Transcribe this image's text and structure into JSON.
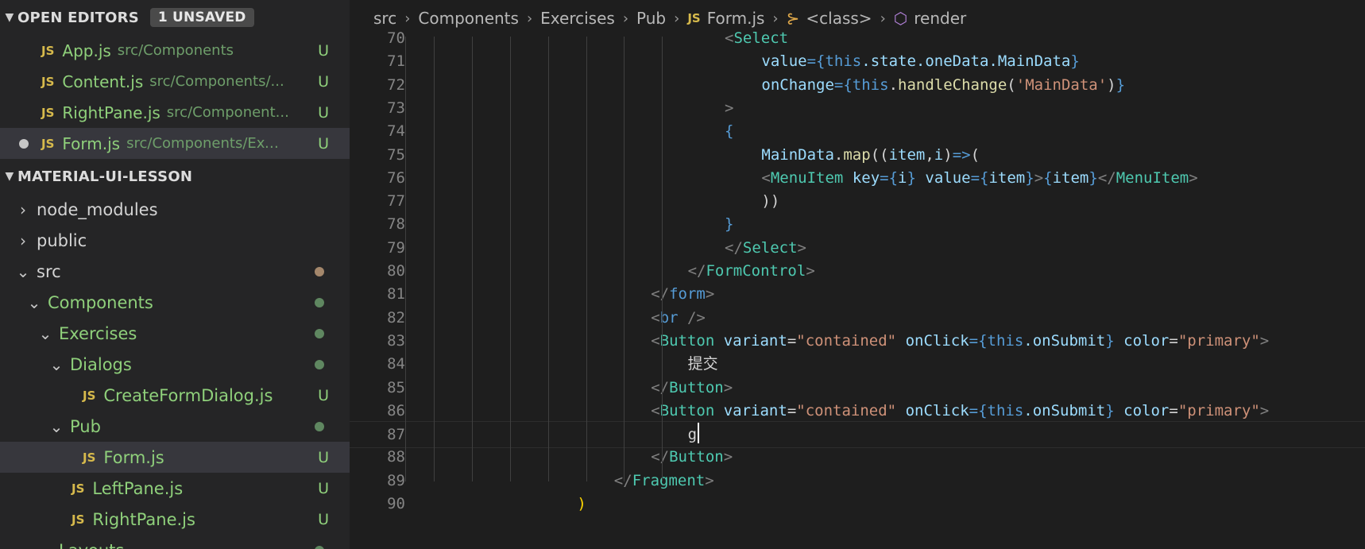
{
  "sidebar": {
    "open_editors": {
      "title": "OPEN EDITORS",
      "badge": "1 UNSAVED",
      "items": [
        {
          "name": "App.js",
          "path": "src/Components",
          "status": "U",
          "unsaved": false
        },
        {
          "name": "Content.js",
          "path": "src/Components/...",
          "status": "U",
          "unsaved": false
        },
        {
          "name": "RightPane.js",
          "path": "src/Component...",
          "status": "U",
          "unsaved": false
        },
        {
          "name": "Form.js",
          "path": "src/Components/Exe...",
          "status": "U",
          "unsaved": true
        }
      ]
    },
    "explorer": {
      "title": "MATERIAL-UI-LESSON",
      "items": [
        {
          "label": "node_modules",
          "kind": "folder",
          "expanded": false,
          "depth": 0,
          "style": "plain"
        },
        {
          "label": "public",
          "kind": "folder",
          "expanded": false,
          "depth": 0,
          "style": "plain"
        },
        {
          "label": "src",
          "kind": "folder",
          "expanded": true,
          "depth": 0,
          "style": "plain",
          "marker": "dot-brown"
        },
        {
          "label": "Components",
          "kind": "folder",
          "expanded": true,
          "depth": 1,
          "style": "green",
          "marker": "dot-green"
        },
        {
          "label": "Exercises",
          "kind": "folder",
          "expanded": true,
          "depth": 2,
          "style": "green",
          "marker": "dot-green"
        },
        {
          "label": "Dialogs",
          "kind": "folder",
          "expanded": true,
          "depth": 3,
          "style": "green",
          "marker": "dot-green"
        },
        {
          "label": "CreateFormDialog.js",
          "kind": "file",
          "depth": 4,
          "status": "U"
        },
        {
          "label": "Pub",
          "kind": "folder",
          "expanded": true,
          "depth": 3,
          "style": "green",
          "marker": "dot-green"
        },
        {
          "label": "Form.js",
          "kind": "file",
          "depth": 4,
          "status": "U",
          "selected": true
        },
        {
          "label": "LeftPane.js",
          "kind": "file",
          "depth": 3,
          "status": "U"
        },
        {
          "label": "RightPane.js",
          "kind": "file",
          "depth": 3,
          "status": "U"
        },
        {
          "label": "Layouts",
          "kind": "folder",
          "expanded": true,
          "depth": 2,
          "style": "green",
          "marker": "dot-green"
        }
      ]
    }
  },
  "breadcrumb": {
    "parts": [
      "src",
      "Components",
      "Exercises",
      "Pub"
    ],
    "file": "Form.js",
    "file_icon": "JS",
    "class_symbol": "<class>",
    "method_symbol": "render"
  },
  "editor": {
    "current_line": 87,
    "lines": [
      {
        "n": "70",
        "indent": 15,
        "tokens": [
          [
            "<",
            "ang"
          ],
          [
            "Select",
            "tag"
          ]
        ]
      },
      {
        "n": "71",
        "indent": 17,
        "tokens": [
          [
            "value",
            "attr"
          ],
          [
            "={",
            "brace"
          ],
          [
            "this",
            "kw"
          ],
          [
            ".state.oneData.MainData",
            "attr"
          ],
          [
            "}",
            "brace"
          ]
        ]
      },
      {
        "n": "72",
        "indent": 17,
        "tokens": [
          [
            "onChange",
            "attr"
          ],
          [
            "={",
            "brace"
          ],
          [
            "this",
            "kw"
          ],
          [
            ".",
            "pl"
          ],
          [
            "handleChange",
            "fn"
          ],
          [
            "(",
            "pl"
          ],
          [
            "'MainData'",
            "str"
          ],
          [
            ")",
            "pl"
          ],
          [
            "}",
            "brace"
          ]
        ]
      },
      {
        "n": "73",
        "indent": 15,
        "tokens": [
          [
            ">",
            "ang"
          ]
        ]
      },
      {
        "n": "74",
        "indent": 15,
        "tokens": [
          [
            "{",
            "brace"
          ]
        ]
      },
      {
        "n": "75",
        "indent": 17,
        "tokens": [
          [
            "MainData",
            "attr"
          ],
          [
            ".",
            "pl"
          ],
          [
            "map",
            "fn"
          ],
          [
            "((",
            "pl"
          ],
          [
            "item",
            "attr"
          ],
          [
            ",",
            "pl"
          ],
          [
            "i",
            "attr"
          ],
          [
            ")",
            "pl"
          ],
          [
            "=>",
            "kw"
          ],
          [
            "(",
            "pl"
          ]
        ]
      },
      {
        "n": "76",
        "indent": 17,
        "tokens": [
          [
            "<",
            "ang"
          ],
          [
            "MenuItem",
            "tag"
          ],
          [
            " ",
            "pl"
          ],
          [
            "key",
            "attr"
          ],
          [
            "={",
            "brace"
          ],
          [
            "i",
            "attr"
          ],
          [
            "}",
            "brace"
          ],
          [
            " ",
            "pl"
          ],
          [
            "value",
            "attr"
          ],
          [
            "={",
            "brace"
          ],
          [
            "item",
            "attr"
          ],
          [
            "}",
            "brace"
          ],
          [
            ">",
            "ang"
          ],
          [
            "{",
            "brace"
          ],
          [
            "item",
            "attr"
          ],
          [
            "}",
            "brace"
          ],
          [
            "</",
            "ang"
          ],
          [
            "MenuItem",
            "tag"
          ],
          [
            ">",
            "ang"
          ]
        ]
      },
      {
        "n": "77",
        "indent": 17,
        "tokens": [
          [
            "))",
            "pl"
          ]
        ]
      },
      {
        "n": "78",
        "indent": 15,
        "tokens": [
          [
            "}",
            "brace"
          ]
        ]
      },
      {
        "n": "79",
        "indent": 15,
        "tokens": [
          [
            "</",
            "ang"
          ],
          [
            "Select",
            "tag"
          ],
          [
            ">",
            "ang"
          ]
        ]
      },
      {
        "n": "80",
        "indent": 13,
        "tokens": [
          [
            "</",
            "ang"
          ],
          [
            "FormControl",
            "tag"
          ],
          [
            ">",
            "ang"
          ]
        ]
      },
      {
        "n": "81",
        "indent": 11,
        "tokens": [
          [
            "</",
            "ang"
          ],
          [
            "form",
            "html"
          ],
          [
            ">",
            "ang"
          ]
        ]
      },
      {
        "n": "82",
        "indent": 11,
        "tokens": [
          [
            "<",
            "ang"
          ],
          [
            "br",
            "html"
          ],
          [
            " />",
            "ang"
          ]
        ]
      },
      {
        "n": "83",
        "indent": 11,
        "tokens": [
          [
            "<",
            "ang"
          ],
          [
            "Button",
            "tag"
          ],
          [
            " ",
            "pl"
          ],
          [
            "variant",
            "attr"
          ],
          [
            "=",
            "pl"
          ],
          [
            "\"contained\"",
            "str"
          ],
          [
            " ",
            "pl"
          ],
          [
            "onClick",
            "attr"
          ],
          [
            "={",
            "brace"
          ],
          [
            "this",
            "kw"
          ],
          [
            ".onSubmit",
            "attr"
          ],
          [
            "}",
            "brace"
          ],
          [
            " ",
            "pl"
          ],
          [
            "color",
            "attr"
          ],
          [
            "=",
            "pl"
          ],
          [
            "\"primary\"",
            "str"
          ],
          [
            ">",
            "ang"
          ]
        ]
      },
      {
        "n": "84",
        "indent": 13,
        "tokens": [
          [
            "提交",
            "pl"
          ]
        ]
      },
      {
        "n": "85",
        "indent": 11,
        "tokens": [
          [
            "</",
            "ang"
          ],
          [
            "Button",
            "tag"
          ],
          [
            ">",
            "ang"
          ]
        ]
      },
      {
        "n": "86",
        "indent": 11,
        "tokens": [
          [
            "<",
            "ang"
          ],
          [
            "Button",
            "tag"
          ],
          [
            " ",
            "pl"
          ],
          [
            "variant",
            "attr"
          ],
          [
            "=",
            "pl"
          ],
          [
            "\"contained\"",
            "str"
          ],
          [
            " ",
            "pl"
          ],
          [
            "onClick",
            "attr"
          ],
          [
            "={",
            "brace"
          ],
          [
            "this",
            "kw"
          ],
          [
            ".onSubmit",
            "attr"
          ],
          [
            "}",
            "brace"
          ],
          [
            " ",
            "pl"
          ],
          [
            "color",
            "attr"
          ],
          [
            "=",
            "pl"
          ],
          [
            "\"primary\"",
            "str"
          ],
          [
            ">",
            "ang"
          ]
        ]
      },
      {
        "n": "87",
        "indent": 13,
        "tokens": [
          [
            "g",
            "pl"
          ]
        ]
      },
      {
        "n": "88",
        "indent": 11,
        "tokens": [
          [
            "</",
            "ang"
          ],
          [
            "Button",
            "tag"
          ],
          [
            ">",
            "ang"
          ]
        ]
      },
      {
        "n": "89",
        "indent": 9,
        "tokens": [
          [
            "</",
            "ang"
          ],
          [
            "Fragment",
            "tag"
          ],
          [
            ">",
            "ang"
          ]
        ]
      },
      {
        "n": "90",
        "indent": 7,
        "tokens": [
          [
            ")",
            "yel"
          ]
        ]
      }
    ]
  }
}
